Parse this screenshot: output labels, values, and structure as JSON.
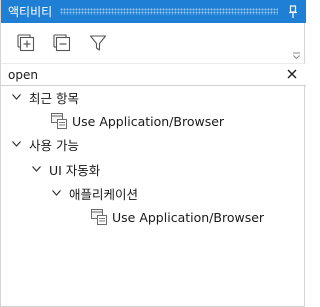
{
  "panel": {
    "title": "액티비티",
    "accent_color": "#1e7fd4",
    "pin_icon": "pin-icon"
  },
  "toolbar": {
    "buttons": [
      {
        "icon": "expand-all-icon"
      },
      {
        "icon": "collapse-all-icon"
      },
      {
        "icon": "filter-icon"
      }
    ]
  },
  "search": {
    "value": "open",
    "clear_icon": "close-icon"
  },
  "tree": {
    "recent": {
      "label": "최근 항목",
      "expanded": true,
      "items": [
        {
          "label": "Use Application/Browser",
          "icon": "use-application-browser-icon"
        }
      ]
    },
    "available": {
      "label": "사용 가능",
      "expanded": true,
      "ui_automation": {
        "label": "UI 자동화",
        "expanded": true,
        "application": {
          "label": "애플리케이션",
          "expanded": true,
          "items": [
            {
              "label": "Use Application/Browser",
              "icon": "use-application-browser-icon"
            }
          ]
        }
      }
    }
  }
}
